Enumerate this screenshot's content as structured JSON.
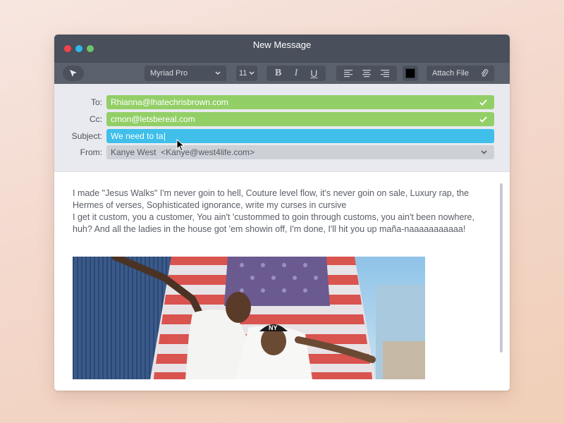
{
  "window": {
    "title": "New Message",
    "traffic_lights": [
      "close",
      "minimize",
      "zoom"
    ]
  },
  "toolbar": {
    "pointer_icon": "cursor-arrow-icon",
    "font_family": "Myriad Pro",
    "font_size": "11",
    "format_buttons": [
      "B",
      "I",
      "U"
    ],
    "align_icons": [
      "align-left-icon",
      "align-center-icon",
      "align-right-icon"
    ],
    "text_color": "#000000",
    "attach_label": "Attach File",
    "attach_icon": "paperclip-icon"
  },
  "headers": {
    "to_label": "To:",
    "to_value": "Rhianna@lhatechrisbrown.com",
    "cc_label": "Cc:",
    "cc_value": "cmon@letsbereal.com",
    "subject_label": "Subject:",
    "subject_value": "We need to ta",
    "from_label": "From:",
    "from_value": "Kanye West  <Kanye@west4life.com>"
  },
  "body": {
    "paragraph1": "I made \"Jesus Walks\" I'm never goin to hell, Couture level flow, it's never goin on sale, Luxury rap, the Hermes of verses, Sophisticated ignorance, write my curses in cursive",
    "paragraph2": "I get it custom, you a customer, You ain't 'custommed to goin through customs, you ain't been nowhere, huh? And all the ladies in the house got 'em showin off, I'm done, I'll hit you up maña-naaaaaaaaaaa!",
    "photo_cap_text": "NY"
  },
  "colors": {
    "titlebar": "#494f5b",
    "toolbar": "#5a606c",
    "valid_field": "#93cf67",
    "active_field": "#3fbfea",
    "from_field": "#cdd0d6"
  }
}
